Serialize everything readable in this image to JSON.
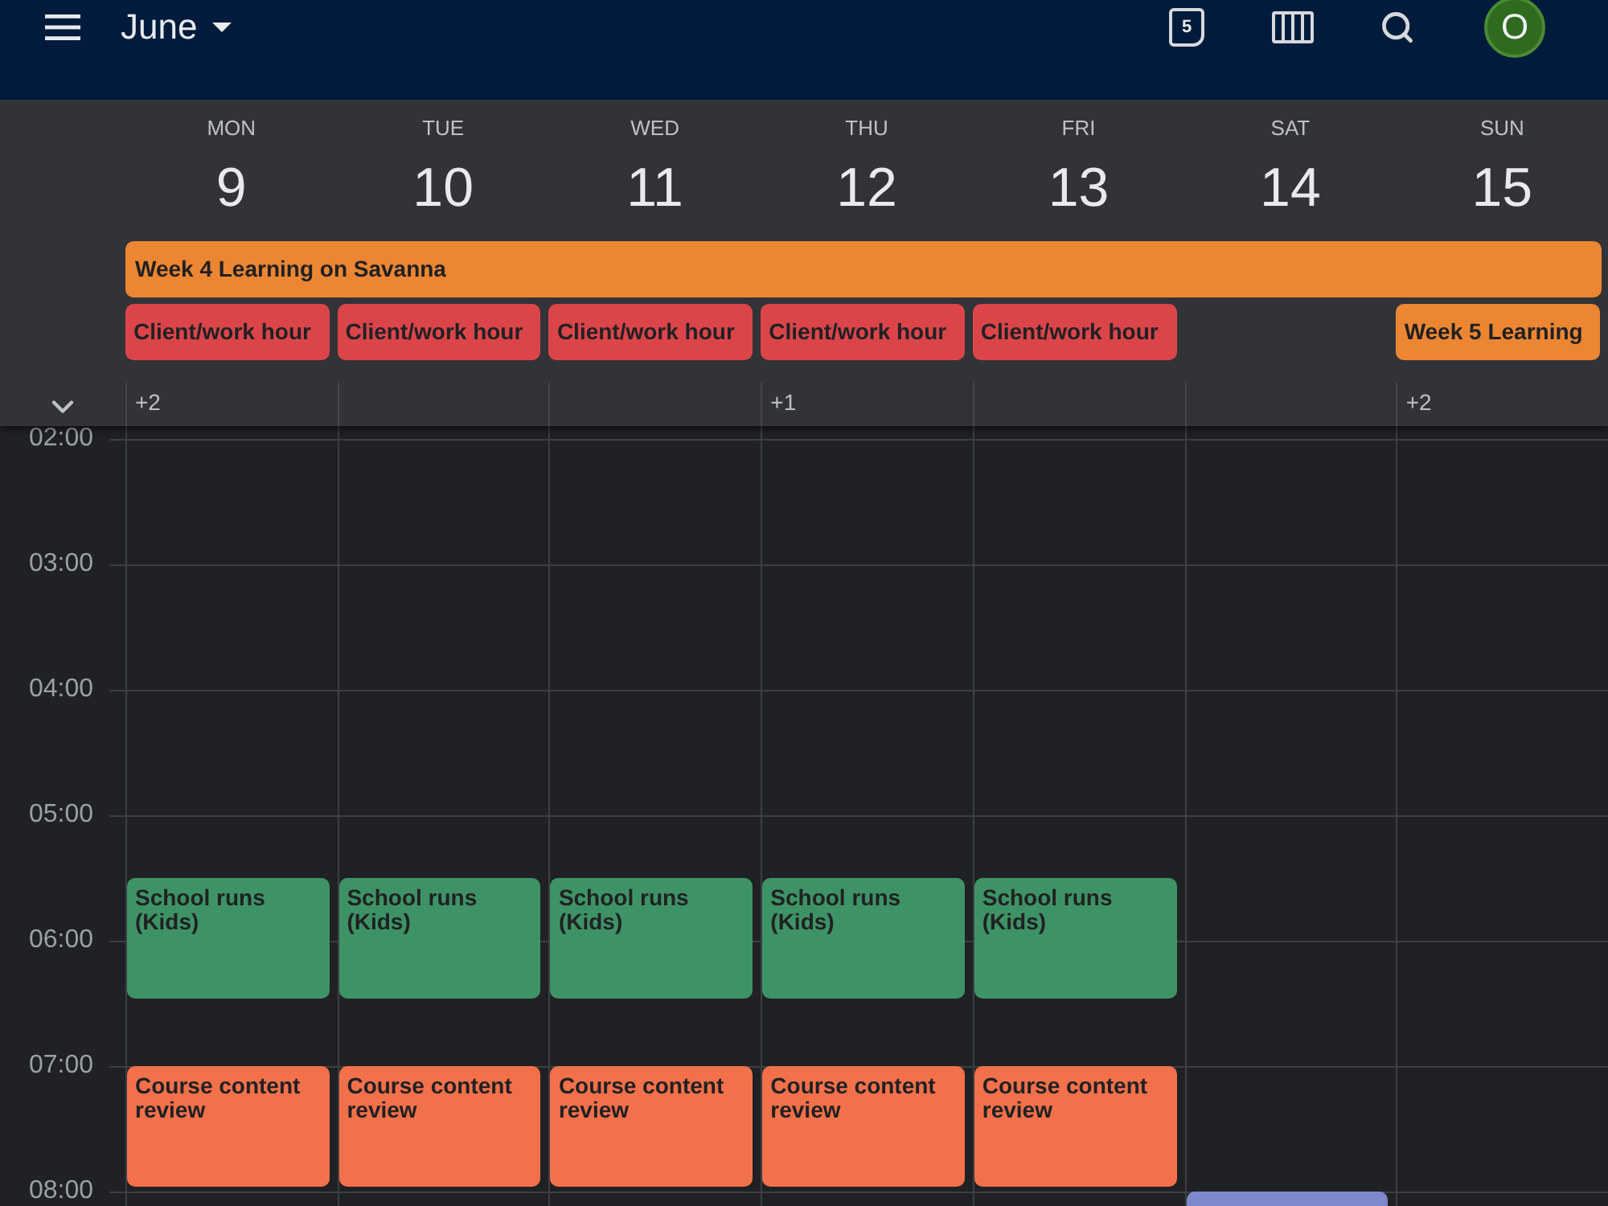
{
  "top_bar": {
    "month": "June",
    "today": "5",
    "avatar_initial": "O"
  },
  "days": [
    {
      "name": "MON",
      "date": "9",
      "all_day_events": [
        {
          "title": "Client/work hour",
          "color": "#db4549"
        }
      ],
      "more": "+2",
      "events": [
        {
          "title": "School runs (Kids)",
          "color": "#3e9366"
        },
        {
          "title": "Course content review",
          "color": "#f2714a"
        }
      ]
    },
    {
      "name": "TUE",
      "date": "10",
      "all_day_events": [
        {
          "title": "Client/work hour",
          "color": "#db4549"
        }
      ],
      "events": [
        {
          "title": "School runs (Kids)",
          "color": "#3e9366"
        },
        {
          "title": "Course content review",
          "color": "#f2714a"
        }
      ]
    },
    {
      "name": "WED",
      "date": "11",
      "all_day_events": [
        {
          "title": "Client/work hour",
          "color": "#db4549"
        }
      ],
      "events": [
        {
          "title": "School runs (Kids)",
          "color": "#3e9366"
        },
        {
          "title": "Course content review",
          "color": "#f2714a"
        }
      ]
    },
    {
      "name": "THU",
      "date": "12",
      "all_day_events": [
        {
          "title": "Client/work hour",
          "color": "#db4549"
        }
      ],
      "more": "+1",
      "events": [
        {
          "title": "School runs (Kids)",
          "color": "#3e9366"
        },
        {
          "title": "Course content review",
          "color": "#f2714a"
        }
      ]
    },
    {
      "name": "FRI",
      "date": "13",
      "all_day_events": [
        {
          "title": "Client/work hour",
          "color": "#db4549"
        }
      ],
      "events": [
        {
          "title": "School runs (Kids)",
          "color": "#3e9366"
        },
        {
          "title": "Course content review",
          "color": "#f2714a"
        }
      ]
    },
    {
      "name": "SAT",
      "date": "14",
      "events": [
        {
          "color": "#7f88cc"
        }
      ]
    },
    {
      "name": "SUN",
      "date": "15",
      "all_day_events": [
        {
          "title": "Week 5 Learning",
          "color": "#ec8632"
        }
      ],
      "more": "+2"
    }
  ],
  "multi_day_events": [
    {
      "title": "Week 4 Learning on Savanna",
      "color": "#ec8632"
    }
  ],
  "hours": [
    "02:00",
    "03:00",
    "04:00",
    "05:00",
    "06:00",
    "07:00",
    "08:00"
  ]
}
